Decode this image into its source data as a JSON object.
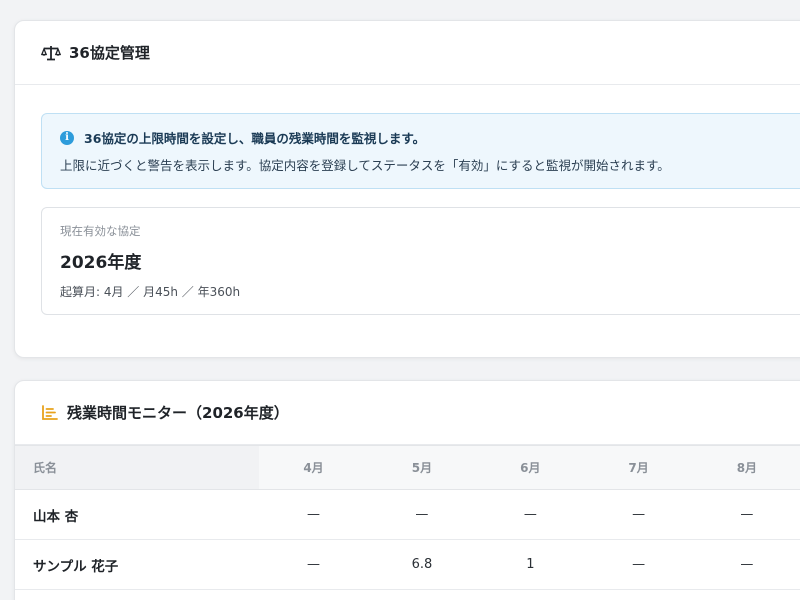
{
  "agreement_card": {
    "title": "36協定管理",
    "icon": "scale-icon",
    "info": {
      "icon": "info-icon",
      "headline": "36協定の上限時間を設定し、職員の残業時間を監視します。",
      "body": "上限に近づくと警告を表示します。協定内容を登録してステータスを「有効」にすると監視が開始されます。"
    },
    "current": {
      "label": "現在有効な協定",
      "year": "2026年度",
      "meta": "起算月: 4月 ／ 月45h ／ 年360h"
    }
  },
  "monitor_card": {
    "title": "残業時間モニター（2026年度）",
    "icon": "bar-chart-icon",
    "accent_color": "#e8a21c",
    "columns": [
      "氏名",
      "4月",
      "5月",
      "6月",
      "7月",
      "8月"
    ],
    "rows": [
      {
        "name": "山本 杏",
        "values": [
          "—",
          "—",
          "—",
          "—",
          "—"
        ]
      },
      {
        "name": "サンプル 花子",
        "values": [
          "—",
          "6.8",
          "1",
          "—",
          "—"
        ]
      }
    ]
  }
}
